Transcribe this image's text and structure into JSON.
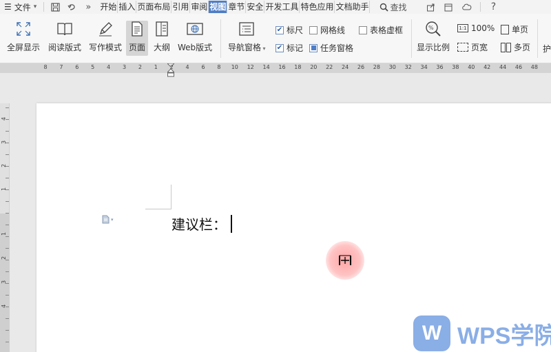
{
  "menubar": {
    "hamburger": "☰",
    "file_label": "文件",
    "tabs": [
      "开始",
      "插入",
      "页面布局",
      "引用",
      "审阅",
      "视图",
      "章节",
      "安全",
      "开发工具",
      "特色应用",
      "文档助手"
    ],
    "active_tab_index": 5,
    "search_label": "查找"
  },
  "ribbon": {
    "fullscreen": "全屏显示",
    "reading": "阅读版式",
    "writing": "写作模式",
    "page": "页面",
    "outline": "大纲",
    "web": "Web版式",
    "navigation": "导航窗格",
    "ruler": "标尺",
    "gridlines": "网格线",
    "table_gridlines": "表格虚框",
    "marks": "标记",
    "task_pane": "任务窗格",
    "zoom": "显示比例",
    "zoom_100": "100%",
    "single_page": "单页",
    "page_width": "页宽",
    "multi_page": "多页",
    "protect_partial": "护"
  },
  "checkboxes": {
    "ruler": true,
    "gridlines": false,
    "table_gridlines": false,
    "marks": true,
    "task_pane": true
  },
  "ruler_numbers": [
    "8",
    "7",
    "6",
    "5",
    "4",
    "3",
    "2",
    "1",
    "2",
    "4",
    "6",
    "8",
    "10",
    "12",
    "14",
    "16",
    "18",
    "20",
    "22",
    "24",
    "26",
    "28",
    "30",
    "32",
    "34",
    "36",
    "38",
    "40",
    "42",
    "44",
    "46",
    "48"
  ],
  "vruler_numbers": [
    "4",
    "3",
    "2",
    "1",
    "1",
    "2",
    "3",
    "4"
  ],
  "document": {
    "text": "建议栏："
  },
  "watermark": {
    "logo": "W",
    "text": "WPS学院"
  },
  "colors": {
    "active_tab": "#4f7ec7",
    "watermark": "#8aaee6",
    "cursor_halo": "#ffa0a0"
  }
}
